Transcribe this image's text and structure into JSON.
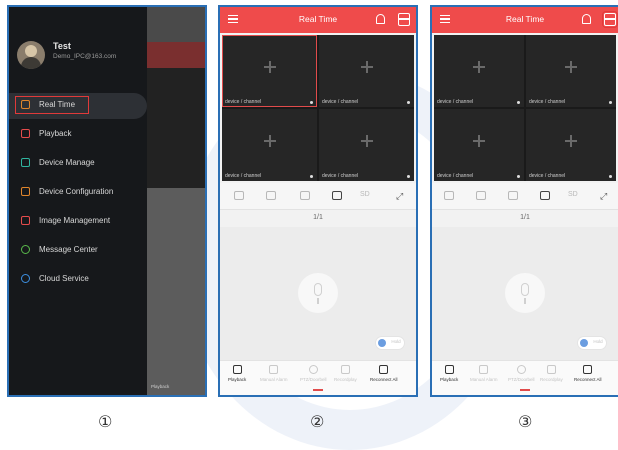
{
  "panel1": {
    "user": {
      "name": "Test",
      "email": "Demo_IPC@163.com"
    },
    "menu": [
      {
        "label": "Real Time",
        "icon": "play-square-icon",
        "color": "#e0852b"
      },
      {
        "label": "Playback",
        "icon": "film-icon",
        "color": "#e64c4c"
      },
      {
        "label": "Device Manage",
        "icon": "camera-icon",
        "color": "#2fb5a0"
      },
      {
        "label": "Device Configuration",
        "icon": "settings-box-icon",
        "color": "#e0852b"
      },
      {
        "label": "Image Management",
        "icon": "image-icon",
        "color": "#e64c4c"
      },
      {
        "label": "Message Center",
        "icon": "chat-icon",
        "color": "#59b94b"
      },
      {
        "label": "Cloud Service",
        "icon": "cloud-icon",
        "color": "#3d8fe0"
      }
    ],
    "underlay_nav_label": "Playback"
  },
  "phone": {
    "title": "Real Time",
    "cells": [
      "device / channel",
      "device / channel",
      "device / channel",
      "device / channel"
    ],
    "tool_text": "SD",
    "page_indicator": "1/1",
    "toggle_label": "Hold",
    "nav": [
      "Playback",
      "Manual Alarm",
      "PTZ/Doorbell",
      "Recordplay",
      "Reconnect All"
    ]
  },
  "steps": [
    "①",
    "②",
    "③"
  ],
  "colors": {
    "accent_red": "#ef4b4b",
    "frame_blue": "#2a6fb5",
    "highlight_red": "#e03a3a"
  }
}
